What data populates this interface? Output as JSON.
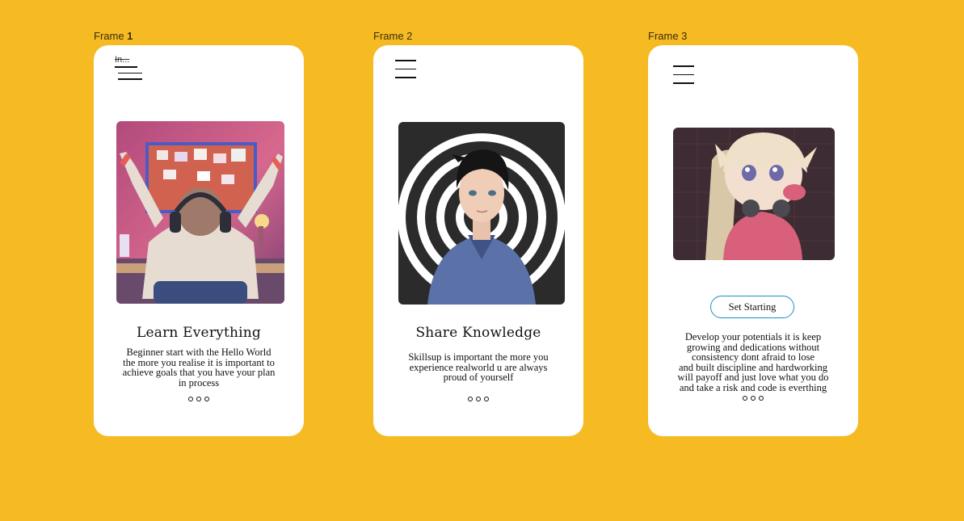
{
  "frames": [
    {
      "label_prefix": "Frame ",
      "label_number": "1",
      "menu_label": "In...",
      "title": "Learn Everything",
      "body": [
        "Beginner start with the Hello World",
        "the more you realise it is important to",
        "achieve goals that you have your plan",
        "in process"
      ]
    },
    {
      "label": "Frame 2",
      "title": "Share Knowledge",
      "body": [
        "Skillsup is important the more you",
        "experience realworld u are always",
        "proud of yourself"
      ]
    },
    {
      "label": "Frame 3",
      "button_label": "Set Starting",
      "body": [
        "Develop your potentials it is keep",
        "growing and dedications without",
        "consistency dont afraid to lose",
        "and built discipline and hardworking",
        "will payoff and just love what you do",
        "and take a risk and code is everthing"
      ]
    }
  ],
  "colors": {
    "background": "#F6BA22",
    "card": "#FFFFFF",
    "button_border": "#1A8FC7"
  }
}
